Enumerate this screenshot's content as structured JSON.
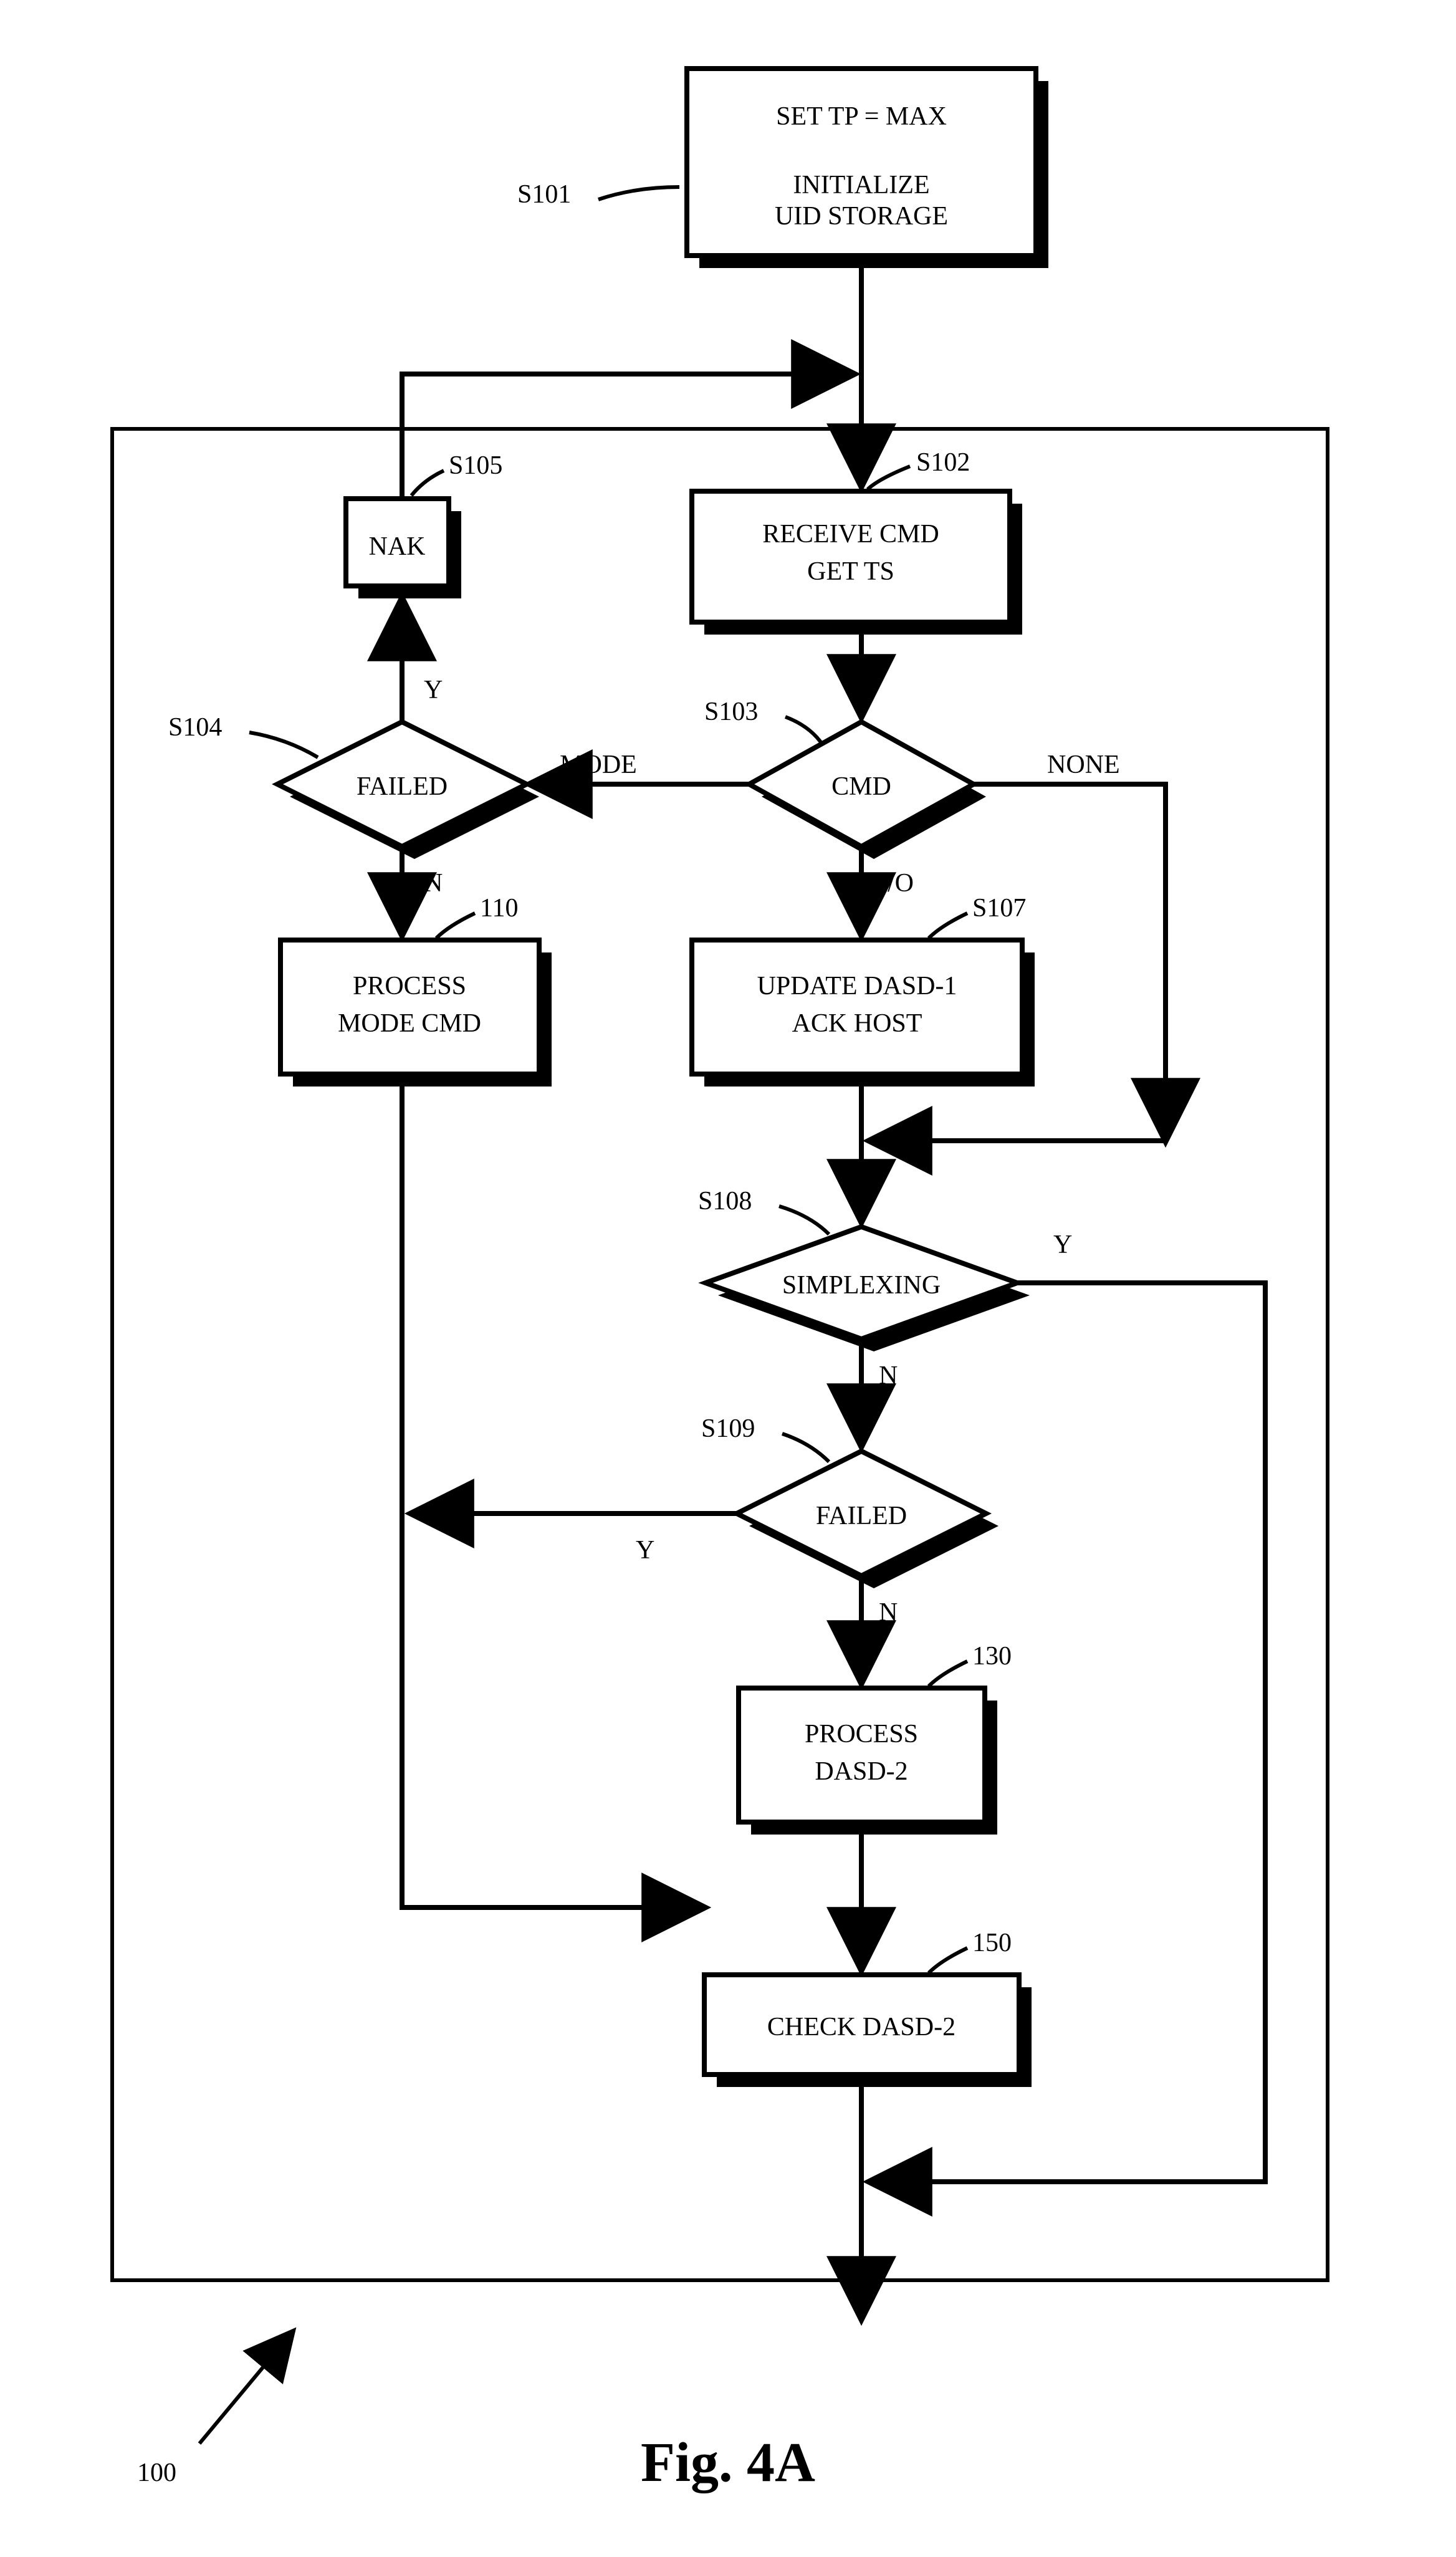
{
  "nodes": {
    "s101": {
      "line1": "SET TP = MAX",
      "line2": "INITIALIZE",
      "line3": "UID STORAGE",
      "ref": "S101"
    },
    "s102": {
      "line1": "RECEIVE CMD",
      "line2": "GET TS",
      "ref": "S102"
    },
    "s103": {
      "label": "CMD",
      "ref": "S103"
    },
    "s104": {
      "label": "FAILED",
      "ref": "S104"
    },
    "s105": {
      "label": "NAK",
      "ref": "S105"
    },
    "s107": {
      "line1": "UPDATE DASD-1",
      "line2": "ACK HOST",
      "ref": "S107"
    },
    "s108": {
      "label": "SIMPLEXING",
      "ref": "S108"
    },
    "s109": {
      "label": "FAILED",
      "ref": "S109"
    },
    "b110": {
      "line1": "PROCESS",
      "line2": "MODE CMD",
      "ref": "110"
    },
    "b130": {
      "line1": "PROCESS",
      "line2": "DASD-2",
      "ref": "130"
    },
    "b150": {
      "label": "CHECK DASD-2",
      "ref": "150"
    }
  },
  "edges": {
    "s103_left": "MODE",
    "s103_right": "NONE",
    "s103_down": "I/O",
    "s104_up": "Y",
    "s104_down": "N",
    "s108_right": "Y",
    "s108_down": "N",
    "s109_left": "Y",
    "s109_down": "N"
  },
  "figure": {
    "title": "Fig. 4A",
    "ref": "100"
  }
}
